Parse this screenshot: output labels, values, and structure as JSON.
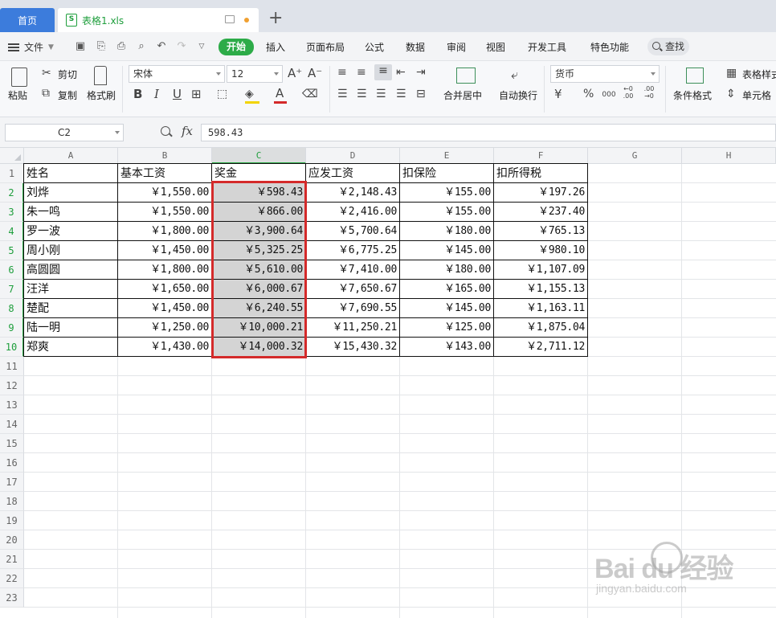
{
  "tabs": {
    "home": "首页",
    "file": "表格1.xls",
    "file_icon_letter": "S",
    "add": "+"
  },
  "menu": {
    "file_label": "文件",
    "tabs": [
      "开始",
      "插入",
      "页面布局",
      "公式",
      "数据",
      "审阅",
      "视图",
      "开发工具",
      "特色功能"
    ],
    "active_tab": "开始",
    "search_label": "查找"
  },
  "ribbon": {
    "paste": "粘贴",
    "cut": "剪切",
    "copy": "复制",
    "format_painter": "格式刷",
    "font_name": "宋体",
    "font_size": "12",
    "bold": "B",
    "italic": "I",
    "underline": "U",
    "merge_center": "合并居中",
    "wrap_text": "自动换行",
    "number_format": "货币",
    "currency_symbol": "¥",
    "percent": "%",
    "thousands": "000",
    "inc_decimal": "←0 .00",
    "dec_decimal": ".00 →0",
    "conditional_format": "条件格式",
    "table_style": "表格样式",
    "cell_style": "单元格"
  },
  "formula_bar": {
    "name_box": "C2",
    "fx": "fx",
    "value": "598.43"
  },
  "grid": {
    "columns": [
      "A",
      "B",
      "C",
      "D",
      "E",
      "F",
      "G",
      "H"
    ],
    "selected_column": "C",
    "row_numbers": [
      "1",
      "2",
      "3",
      "4",
      "5",
      "6",
      "7",
      "8",
      "9",
      "10",
      "11",
      "12",
      "13",
      "14",
      "15",
      "16",
      "17",
      "18",
      "19",
      "20",
      "21",
      "22",
      "23"
    ],
    "headers": [
      "姓名",
      "基本工资",
      "奖金",
      "应发工资",
      "扣保险",
      "扣所得税"
    ],
    "rows": [
      [
        "刘烨",
        "￥1,550.00",
        "￥598.43",
        "￥2,148.43",
        "￥155.00",
        "￥197.26"
      ],
      [
        "朱一鸣",
        "￥1,550.00",
        "￥866.00",
        "￥2,416.00",
        "￥155.00",
        "￥237.40"
      ],
      [
        "罗一波",
        "￥1,800.00",
        "￥3,900.64",
        "￥5,700.64",
        "￥180.00",
        "￥765.13"
      ],
      [
        "周小刚",
        "￥1,450.00",
        "￥5,325.25",
        "￥6,775.25",
        "￥145.00",
        "￥980.10"
      ],
      [
        "高圆圆",
        "￥1,800.00",
        "￥5,610.00",
        "￥7,410.00",
        "￥180.00",
        "￥1,107.09"
      ],
      [
        "汪洋",
        "￥1,650.00",
        "￥6,000.67",
        "￥7,650.67",
        "￥165.00",
        "￥1,155.13"
      ],
      [
        "楚配",
        "￥1,450.00",
        "￥6,240.55",
        "￥7,690.55",
        "￥145.00",
        "￥1,163.11"
      ],
      [
        "陆一明",
        "￥1,250.00",
        "￥10,000.21",
        "￥11,250.21",
        "￥125.00",
        "￥1,875.04"
      ],
      [
        "郑爽",
        "￥1,430.00",
        "￥14,000.32",
        "￥15,430.32",
        "￥143.00",
        "￥2,711.12"
      ]
    ]
  },
  "watermark": {
    "brand": "Bai du 经验",
    "url": "jingyan.baidu.com"
  }
}
